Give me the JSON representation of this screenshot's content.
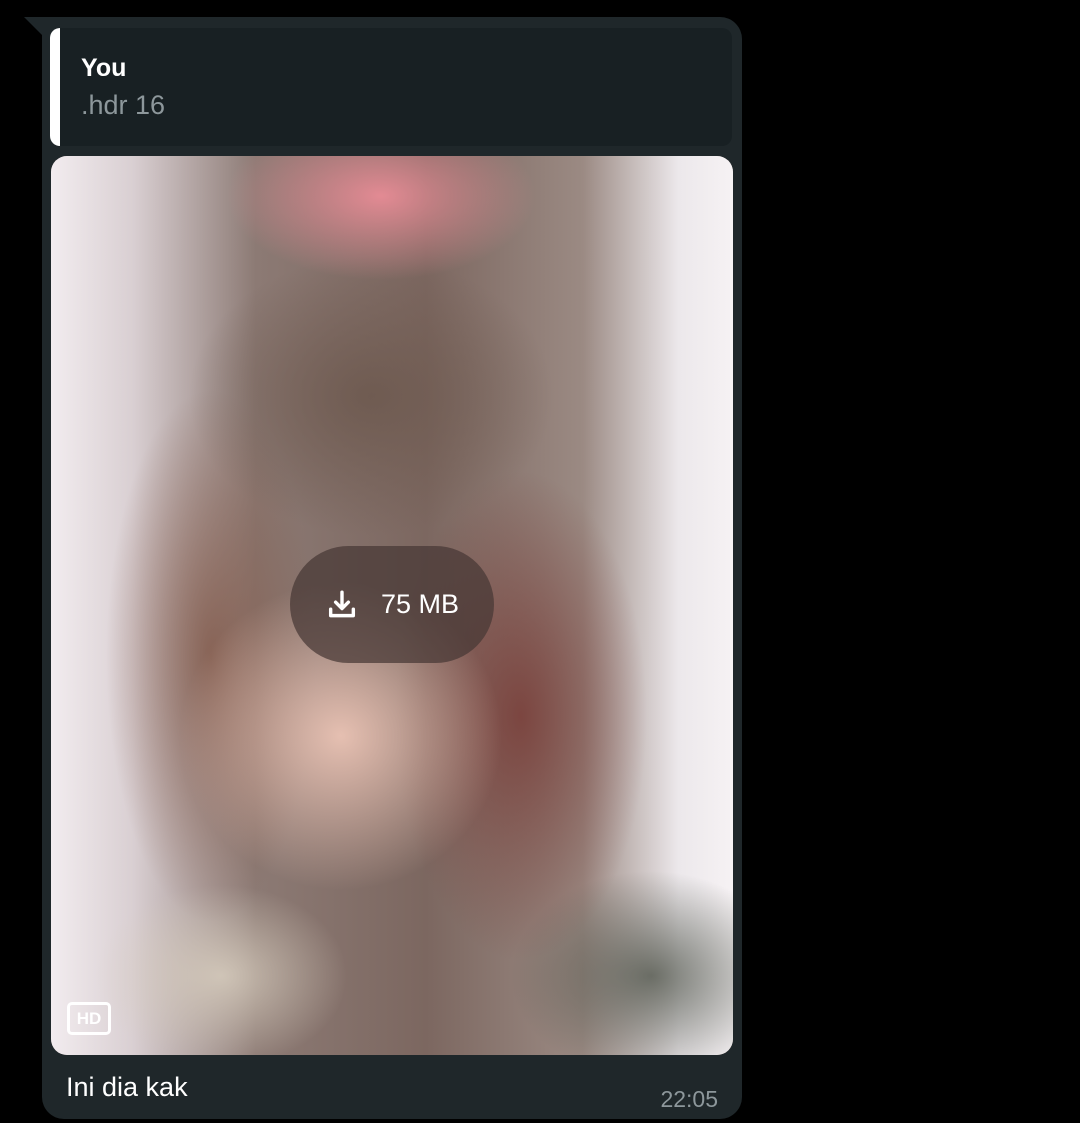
{
  "message": {
    "reply": {
      "author": "You",
      "text": ".hdr 16"
    },
    "media": {
      "download_size": "75 MB",
      "download_icon": "download-icon",
      "quality_badge": "HD"
    },
    "caption": "Ini dia kak",
    "time": "22:05"
  },
  "colors": {
    "background": "#000000",
    "bubble": "#1f272a",
    "quote_background": "#182023",
    "quote_bar": "#ffffff",
    "secondary_text": "#8d979b"
  }
}
